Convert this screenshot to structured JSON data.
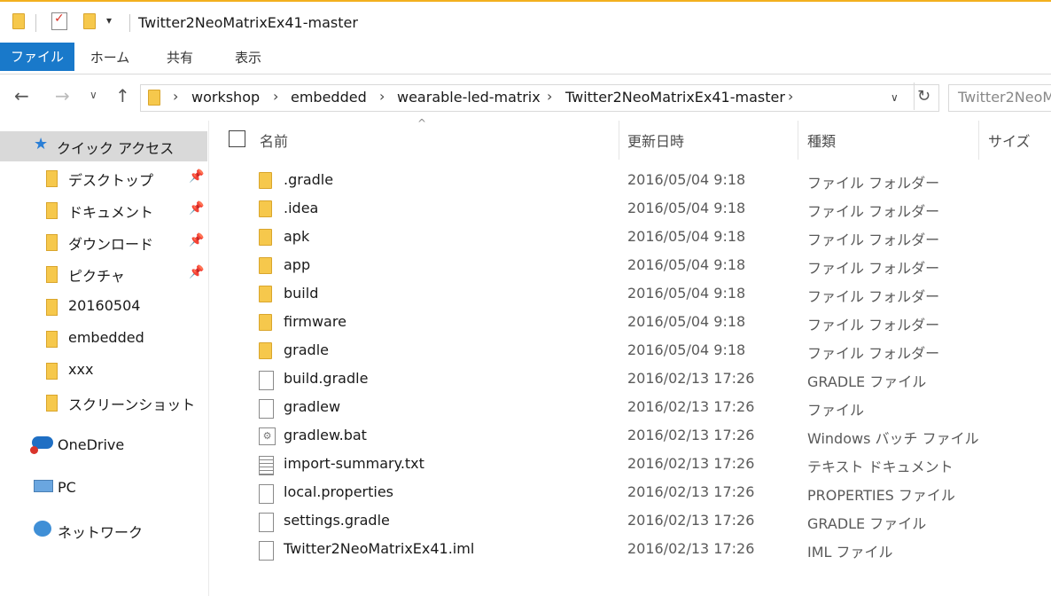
{
  "window": {
    "title": "Twitter2NeoMatrixEx41-master"
  },
  "ribbon": {
    "tabs": [
      "ファイル",
      "ホーム",
      "共有",
      "表示"
    ]
  },
  "address": {
    "crumbs": [
      "workshop",
      "embedded",
      "wearable-led-matrix",
      "Twitter2NeoMatrixEx41-master"
    ],
    "search_placeholder": "Twitter2NeoM"
  },
  "sidebar": {
    "quick_access": "クイック アクセス",
    "items": [
      {
        "label": "デスクトップ",
        "pinned": true
      },
      {
        "label": "ドキュメント",
        "pinned": true
      },
      {
        "label": "ダウンロード",
        "pinned": true
      },
      {
        "label": "ピクチャ",
        "pinned": true
      },
      {
        "label": "20160504",
        "pinned": false
      },
      {
        "label": "embedded",
        "pinned": false
      },
      {
        "label": "xxx",
        "pinned": false
      },
      {
        "label": "スクリーンショット",
        "pinned": false
      }
    ],
    "onedrive": "OneDrive",
    "pc": "PC",
    "network": "ネットワーク"
  },
  "columns": {
    "name": "名前",
    "date": "更新日時",
    "type": "種類",
    "size": "サイズ"
  },
  "files": [
    {
      "name": ".gradle",
      "date": "2016/05/04 9:18",
      "type": "ファイル フォルダー",
      "icon": "folder"
    },
    {
      "name": ".idea",
      "date": "2016/05/04 9:18",
      "type": "ファイル フォルダー",
      "icon": "folder"
    },
    {
      "name": "apk",
      "date": "2016/05/04 9:18",
      "type": "ファイル フォルダー",
      "icon": "folder"
    },
    {
      "name": "app",
      "date": "2016/05/04 9:18",
      "type": "ファイル フォルダー",
      "icon": "folder"
    },
    {
      "name": "build",
      "date": "2016/05/04 9:18",
      "type": "ファイル フォルダー",
      "icon": "folder"
    },
    {
      "name": "firmware",
      "date": "2016/05/04 9:18",
      "type": "ファイル フォルダー",
      "icon": "folder"
    },
    {
      "name": "gradle",
      "date": "2016/05/04 9:18",
      "type": "ファイル フォルダー",
      "icon": "folder"
    },
    {
      "name": "build.gradle",
      "date": "2016/02/13 17:26",
      "type": "GRADLE ファイル",
      "icon": "file"
    },
    {
      "name": "gradlew",
      "date": "2016/02/13 17:26",
      "type": "ファイル",
      "icon": "file"
    },
    {
      "name": "gradlew.bat",
      "date": "2016/02/13 17:26",
      "type": "Windows バッチ ファイル",
      "icon": "batfile"
    },
    {
      "name": "import-summary.txt",
      "date": "2016/02/13 17:26",
      "type": "テキスト ドキュメント",
      "icon": "textfile"
    },
    {
      "name": "local.properties",
      "date": "2016/02/13 17:26",
      "type": "PROPERTIES ファイル",
      "icon": "file"
    },
    {
      "name": "settings.gradle",
      "date": "2016/02/13 17:26",
      "type": "GRADLE ファイル",
      "icon": "file"
    },
    {
      "name": "Twitter2NeoMatrixEx41.iml",
      "date": "2016/02/13 17:26",
      "type": "IML ファイル",
      "icon": "file"
    }
  ]
}
